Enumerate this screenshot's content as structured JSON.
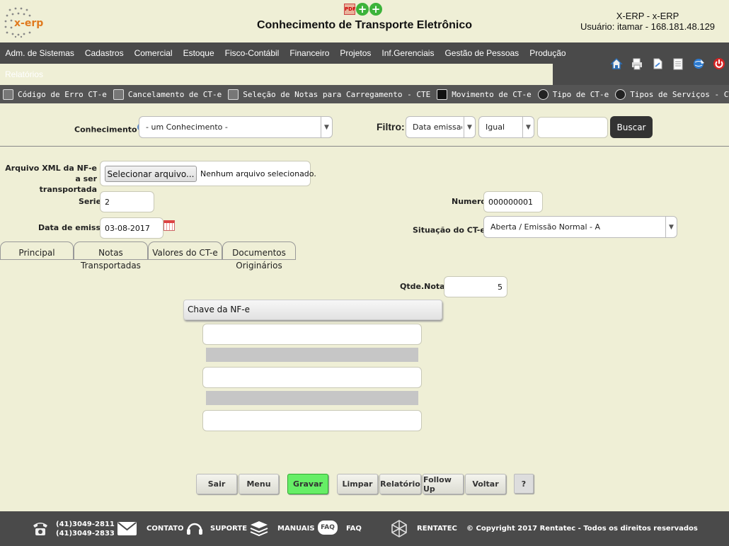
{
  "header": {
    "logo_text": "x-erp",
    "title": "Conhecimento de Transporte Eletrônico",
    "system": "X-ERP - x-ERP",
    "user_line": "Usuário: itamar - 168.181.48.129",
    "icons": [
      "pdf-icon",
      "add-icon",
      "add-icon"
    ]
  },
  "menu": {
    "items": [
      "Adm. de Sistemas",
      "Cadastros",
      "Comercial",
      "Estoque",
      "Fisco-Contábil",
      "Financeiro",
      "Projetos",
      "Inf.Gerenciais",
      "Gestão de Pessoas",
      "Produção"
    ],
    "second_row": "Relatórios",
    "tool_icons": [
      "home-icon",
      "printer-icon",
      "document-icon",
      "list-icon",
      "globe-icon",
      "power-icon"
    ]
  },
  "submenu": {
    "items": [
      {
        "label": "Código de Erro CT-e",
        "icon": "report-icon"
      },
      {
        "label": "Cancelamento de CT-e",
        "icon": "cancel-doc-icon"
      },
      {
        "label": "Seleção de Notas para Carregamento - CTE",
        "icon": "checklist-icon"
      },
      {
        "label": "Movimento de CT-e",
        "icon": "terminal-icon"
      },
      {
        "label": "Tipo de CT-e",
        "icon": "gear-icon"
      },
      {
        "label": "Tipos de Serviços - CTE",
        "icon": "truck-icon"
      }
    ]
  },
  "filter": {
    "conhecimento_label": "Conhecimento",
    "conhecimento_value": "- um Conhecimento -",
    "filtro_label": "Filtro:",
    "field_value": "Data emissao",
    "op_value": "Igual",
    "search_value": "",
    "buscar_label": "Buscar"
  },
  "form": {
    "xml_label_1": "Arquivo XML da NF-e a ser",
    "xml_label_2": "transportada",
    "file_button": "Selecionar arquivo...",
    "file_status": "Nenhum arquivo selecionado.",
    "serie_label": "Serie",
    "serie_value": "2",
    "numero_label": "Numero",
    "numero_value": "000000001",
    "data_label": "Data de emissao",
    "data_value": "03-08-2017",
    "situacao_label": "Situação do CT-e",
    "situacao_value": "Aberta / Emissão Normal - A"
  },
  "tabs": [
    {
      "line1": "Principal",
      "line2": ""
    },
    {
      "line1": "Notas",
      "line2": "Transportadas"
    },
    {
      "line1": "Valores do CT-e",
      "line2": ""
    },
    {
      "line1": "Documentos",
      "line2": "Originários"
    }
  ],
  "notas": {
    "qtde_label": "Qtde.Notas",
    "qtde_value": "5",
    "chave_header": "Chave da NF-e",
    "chaves": [
      "",
      "",
      ""
    ]
  },
  "buttons": [
    "Sair",
    "Menu",
    "Gravar",
    "Limpar",
    "Relatório",
    "Follow Up",
    "Voltar",
    "?"
  ],
  "footer": {
    "phone1": "(41)3049-2811",
    "phone2": "(41)3049-2833",
    "contato": "CONTATO",
    "suporte": "SUPORTE",
    "manuais": "MANUAIS",
    "faq": "FAQ",
    "faq_badge": "FAQ",
    "rentatec": "RENTATEC",
    "copyright": "© Copyright 2017 Rentatec - Todos os direitos reservados"
  },
  "colors": {
    "menu_bg": "#4a4a4a",
    "page_bg": "#efefd6",
    "gravar": "#66ee66",
    "buscar": "#333333"
  }
}
